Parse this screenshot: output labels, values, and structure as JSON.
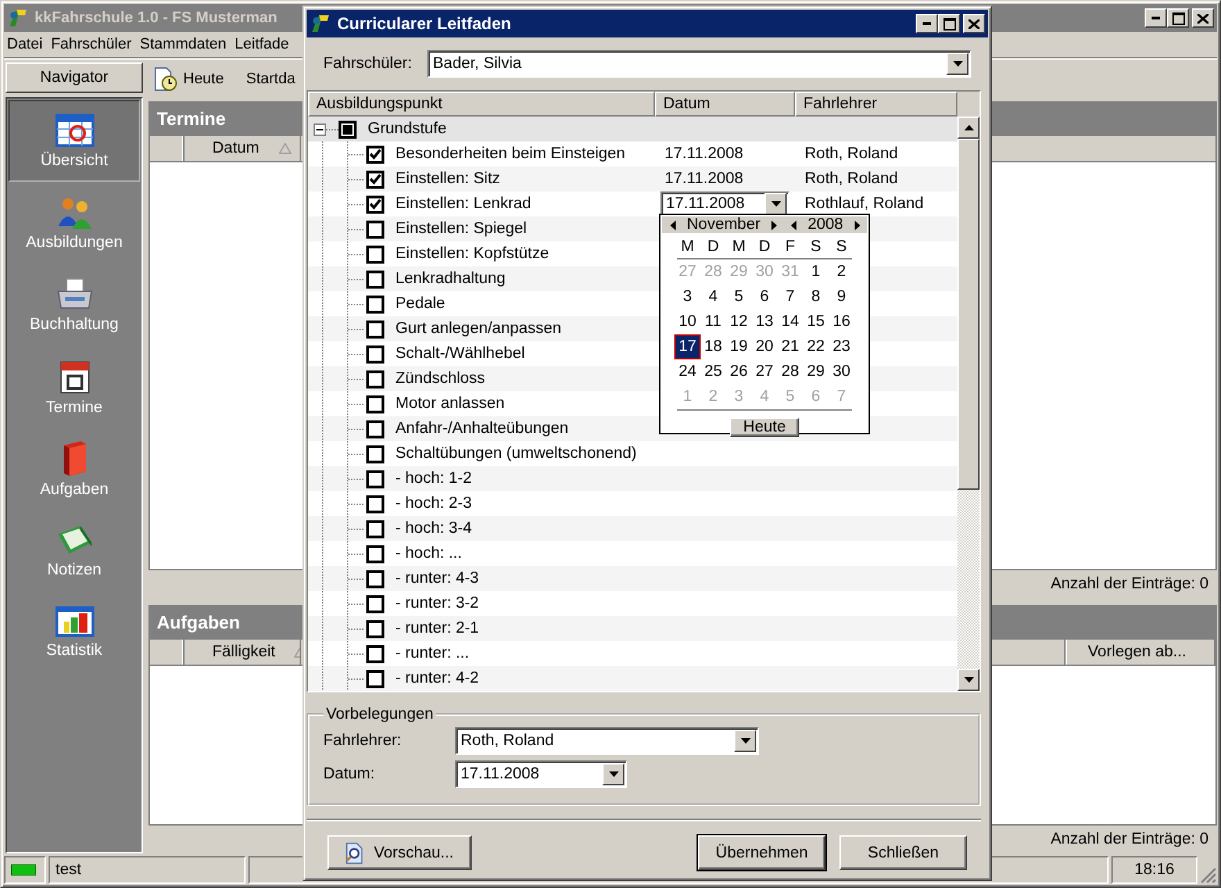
{
  "main_window": {
    "title": "kkFahrschule 1.0 - FS Musterman",
    "menu": [
      "Datei",
      "Fahrschüler",
      "Stammdaten",
      "Leitfade"
    ],
    "navigator": {
      "title": "Navigator",
      "items": [
        {
          "label": "Übersicht",
          "selected": true
        },
        {
          "label": "Ausbildungen",
          "selected": false
        },
        {
          "label": "Buchhaltung",
          "selected": false
        },
        {
          "label": "Termine",
          "selected": false
        },
        {
          "label": "Aufgaben",
          "selected": false
        },
        {
          "label": "Notizen",
          "selected": false
        },
        {
          "label": "Statistik",
          "selected": false
        }
      ]
    },
    "toolbar": [
      "Heute",
      "Startda"
    ],
    "termine": {
      "title": "Termine",
      "columns": [
        {
          "label": "Datum",
          "sorted": true
        }
      ],
      "count": "Anzahl der Einträge: 0"
    },
    "aufgaben": {
      "title": "Aufgaben",
      "columns": [
        {
          "label": "Fälligkeit",
          "sorted": true
        },
        {
          "label": "Vorlegen ab...",
          "sorted": false
        }
      ],
      "count": "Anzahl der Einträge: 0"
    },
    "status_bar": {
      "text": "test",
      "time": "18:16"
    }
  },
  "dialog": {
    "title": "Curricularer Leitfaden",
    "student_label": "Fahrschüler:",
    "student": "Bader, Silvia",
    "tree": {
      "columns": [
        "Ausbildungspunkt",
        "Datum",
        "Fahrlehrer"
      ],
      "root": {
        "label": "Grundstufe",
        "checked": false,
        "partial": true,
        "expanded": true,
        "children": [
          {
            "label": "Besonderheiten beim Einsteigen",
            "checked": true,
            "date": "17.11.2008",
            "instructor": "Roth, Roland",
            "editing": false
          },
          {
            "label": "Einstellen: Sitz",
            "checked": true,
            "date": "17.11.2008",
            "instructor": "Roth, Roland",
            "editing": false
          },
          {
            "label": "Einstellen: Lenkrad",
            "checked": true,
            "date": "17.11.2008",
            "instructor": "Rothlauf, Roland",
            "editing": true
          },
          {
            "label": "Einstellen: Spiegel",
            "checked": false,
            "editing": false
          },
          {
            "label": "Einstellen: Kopfstütze",
            "checked": false,
            "editing": false
          },
          {
            "label": "Lenkradhaltung",
            "checked": false,
            "editing": false
          },
          {
            "label": "Pedale",
            "checked": false,
            "editing": false
          },
          {
            "label": "Gurt anlegen/anpassen",
            "checked": false,
            "editing": false
          },
          {
            "label": "Schalt-/Wählhebel",
            "checked": false,
            "editing": false
          },
          {
            "label": "Zündschloss",
            "checked": false,
            "editing": false
          },
          {
            "label": "Motor anlassen",
            "checked": false,
            "editing": false
          },
          {
            "label": "Anfahr-/Anhalteübungen",
            "checked": false,
            "editing": false
          },
          {
            "label": "Schaltübungen (umweltschonend)",
            "checked": false,
            "editing": false
          },
          {
            "label": "- hoch: 1-2",
            "checked": false,
            "editing": false
          },
          {
            "label": "- hoch: 2-3",
            "checked": false,
            "editing": false
          },
          {
            "label": "- hoch: 3-4",
            "checked": false,
            "editing": false
          },
          {
            "label": "- hoch: ...",
            "checked": false,
            "editing": false
          },
          {
            "label": "- runter: 4-3",
            "checked": false,
            "editing": false
          },
          {
            "label": "- runter: 3-2",
            "checked": false,
            "editing": false
          },
          {
            "label": "- runter: 2-1",
            "checked": false,
            "editing": false
          },
          {
            "label": "- runter: ...",
            "checked": false,
            "editing": false
          },
          {
            "label": "- runter: 4-2",
            "checked": false,
            "editing": false
          }
        ]
      }
    },
    "calendar": {
      "month": "November",
      "year": "2008",
      "weekdays": [
        "M",
        "D",
        "M",
        "D",
        "F",
        "S",
        "S"
      ],
      "weeks": [
        [
          {
            "day": "27",
            "outside": true,
            "selected": false
          },
          {
            "day": "28",
            "outside": true,
            "selected": false
          },
          {
            "day": "29",
            "outside": true,
            "selected": false
          },
          {
            "day": "30",
            "outside": true,
            "selected": false
          },
          {
            "day": "31",
            "outside": true,
            "selected": false
          },
          {
            "day": "1",
            "outside": false,
            "selected": false
          },
          {
            "day": "2",
            "outside": false,
            "selected": false
          }
        ],
        [
          {
            "day": "3",
            "outside": false,
            "selected": false
          },
          {
            "day": "4",
            "outside": false,
            "selected": false
          },
          {
            "day": "5",
            "outside": false,
            "selected": false
          },
          {
            "day": "6",
            "outside": false,
            "selected": false
          },
          {
            "day": "7",
            "outside": false,
            "selected": false
          },
          {
            "day": "8",
            "outside": false,
            "selected": false
          },
          {
            "day": "9",
            "outside": false,
            "selected": false
          }
        ],
        [
          {
            "day": "10",
            "outside": false,
            "selected": false
          },
          {
            "day": "11",
            "outside": false,
            "selected": false
          },
          {
            "day": "12",
            "outside": false,
            "selected": false
          },
          {
            "day": "13",
            "outside": false,
            "selected": false
          },
          {
            "day": "14",
            "outside": false,
            "selected": false
          },
          {
            "day": "15",
            "outside": false,
            "selected": false
          },
          {
            "day": "16",
            "outside": false,
            "selected": false
          }
        ],
        [
          {
            "day": "17",
            "outside": false,
            "selected": true
          },
          {
            "day": "18",
            "outside": false,
            "selected": false
          },
          {
            "day": "19",
            "outside": false,
            "selected": false
          },
          {
            "day": "20",
            "outside": false,
            "selected": false
          },
          {
            "day": "21",
            "outside": false,
            "selected": false
          },
          {
            "day": "22",
            "outside": false,
            "selected": false
          },
          {
            "day": "23",
            "outside": false,
            "selected": false
          }
        ],
        [
          {
            "day": "24",
            "outside": false,
            "selected": false
          },
          {
            "day": "25",
            "outside": false,
            "selected": false
          },
          {
            "day": "26",
            "outside": false,
            "selected": false
          },
          {
            "day": "27",
            "outside": false,
            "selected": false
          },
          {
            "day": "28",
            "outside": false,
            "selected": false
          },
          {
            "day": "29",
            "outside": false,
            "selected": false
          },
          {
            "day": "30",
            "outside": false,
            "selected": false
          }
        ],
        [
          {
            "day": "1",
            "outside": true,
            "selected": false
          },
          {
            "day": "2",
            "outside": true,
            "selected": false
          },
          {
            "day": "3",
            "outside": true,
            "selected": false
          },
          {
            "day": "4",
            "outside": true,
            "selected": false
          },
          {
            "day": "5",
            "outside": true,
            "selected": false
          },
          {
            "day": "6",
            "outside": true,
            "selected": false
          },
          {
            "day": "7",
            "outside": true,
            "selected": false
          }
        ]
      ],
      "button": "Heute"
    },
    "defaults": {
      "title": "Vorbelegungen",
      "instructor_label": "Fahrlehrer:",
      "instructor": "Roth, Roland",
      "date_label": "Datum:",
      "date": "17.11.2008"
    },
    "buttons": [
      {
        "label": "Vorschau...",
        "kind": "preview",
        "default": false
      },
      {
        "label": "Übernehmen",
        "kind": "plain",
        "default": true
      },
      {
        "label": "Schließen",
        "kind": "plain",
        "default": false
      }
    ]
  }
}
